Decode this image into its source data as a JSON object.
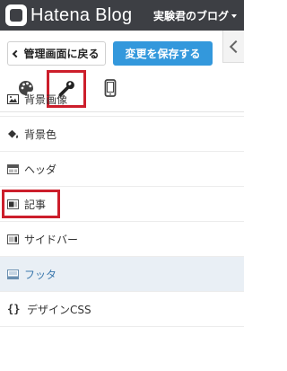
{
  "header": {
    "brand": "Hatena Blog",
    "blog_name": "実験君のブログ"
  },
  "toolbar": {
    "back_label": "管理画面に戻る",
    "save_label": "変更を保存する"
  },
  "tabs": [
    {
      "icon": "palette-icon"
    },
    {
      "icon": "wrench-icon",
      "selected": true
    },
    {
      "icon": "smartphone-icon"
    }
  ],
  "menu": {
    "items": [
      {
        "label": "背景画像",
        "icon": "image-icon"
      },
      {
        "label": "背景色",
        "icon": "paint-bucket-icon"
      },
      {
        "label": "ヘッダ",
        "icon": "layout-header-icon"
      },
      {
        "label": "記事",
        "icon": "layout-article-icon",
        "highlighted": true
      },
      {
        "label": "サイドバー",
        "icon": "layout-sidebar-icon"
      },
      {
        "label": "フッタ",
        "icon": "layout-footer-icon",
        "active": true
      },
      {
        "label": "デザインCSS",
        "icon": "code-icon"
      }
    ]
  },
  "colors": {
    "topbar": "#3d3f44",
    "save_button": "#3398dc",
    "highlight": "#cc1e2b",
    "active_text": "#3b78ad"
  }
}
